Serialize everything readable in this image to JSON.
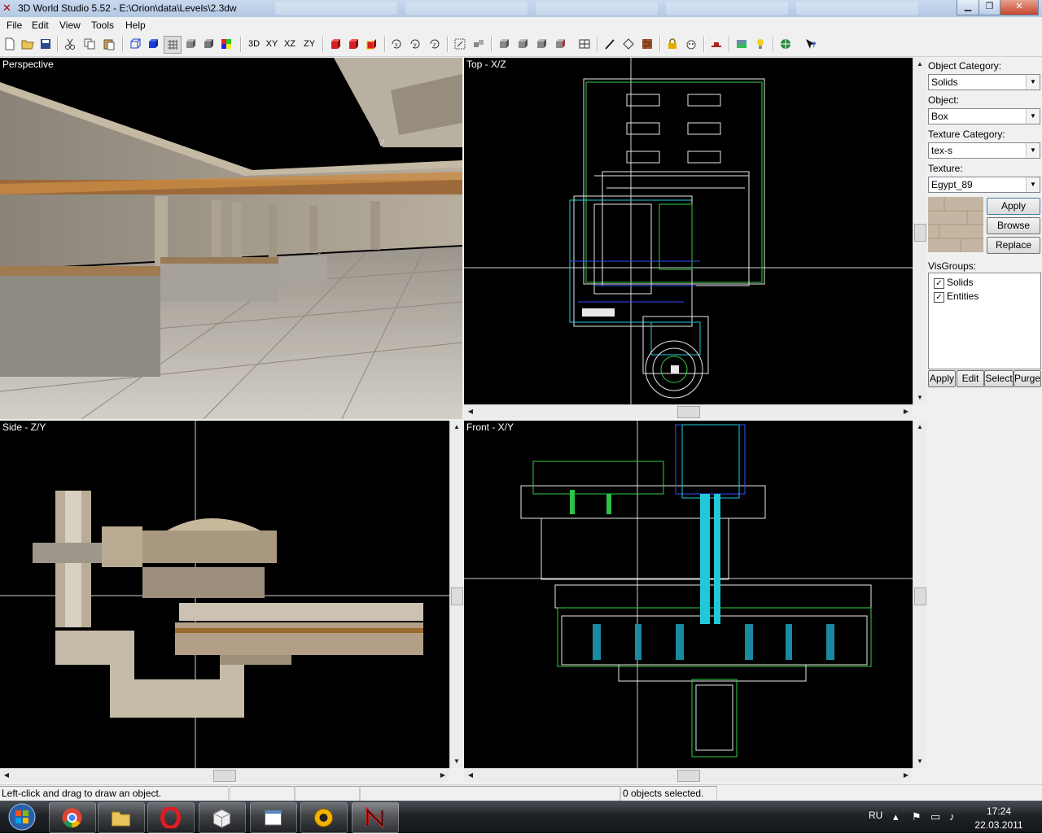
{
  "window": {
    "title": "3D World Studio 5.52 - E:\\Orion\\data\\Levels\\2.3dw",
    "minimize": "▁",
    "restore": "❐",
    "close": "✕"
  },
  "menu": [
    "File",
    "Edit",
    "View",
    "Tools",
    "Help"
  ],
  "toolbar": {
    "view_3d": "3D",
    "view_xy": "XY",
    "view_xz": "XZ",
    "view_zy": "ZY",
    "icons": [
      "new-icon",
      "open-icon",
      "save-icon",
      "cut-icon",
      "copy-icon",
      "paste-icon",
      "cube-wire-icon",
      "cube-solid-icon",
      "grid-icon",
      "shaded-icon",
      "textured-icon",
      "color-icon",
      "red-cube-icon",
      "red-cube-2-icon",
      "red-cube-3-icon",
      "rotate-x-icon",
      "rotate-y-icon",
      "rotate-z-icon",
      "snap-icon",
      "group-icon",
      "solid-1-icon",
      "solid-2-icon",
      "solid-3-icon",
      "solid-4-icon",
      "carve-icon",
      "brush-icon",
      "paint-icon",
      "texture-icon",
      "lock-icon",
      "face-icon",
      "entity-icon",
      "map-icon",
      "light-icon",
      "compile-icon",
      "help-icon"
    ]
  },
  "viewports": {
    "perspective": "Perspective",
    "top": "Top - X/Z",
    "side": "Side - Z/Y",
    "front": "Front - X/Y"
  },
  "panel": {
    "object_category_label": "Object Category:",
    "object_category": "Solids",
    "object_label": "Object:",
    "object": "Box",
    "texture_category_label": "Texture Category:",
    "texture_category": "tex-s",
    "texture_label": "Texture:",
    "texture": "Egypt_89",
    "apply": "Apply",
    "browse": "Browse",
    "replace": "Replace",
    "visgroups_label": "VisGroups:",
    "visgroups": [
      {
        "name": "Solids",
        "checked": true
      },
      {
        "name": "Entities",
        "checked": true
      }
    ],
    "vg_apply": "Apply",
    "vg_edit": "Edit",
    "vg_select": "Select",
    "vg_purge": "Purge",
    "check_mark": "✓"
  },
  "status": {
    "hint": "Left-click and drag to draw an object.",
    "selection": "0 objects selected."
  },
  "taskbar": {
    "apps": [
      "start-orb",
      "chrome",
      "file-explorer",
      "opera",
      "package",
      "notepad",
      "game-shield",
      "3d-world-studio"
    ],
    "lang": "RU",
    "time": "17:24",
    "date": "22.03.2011"
  },
  "colors": {
    "wire_white": "#e8e8e8",
    "wire_green": "#33cc44",
    "wire_cyan": "#22c8d8",
    "wire_blue": "#3050ff",
    "crosshair": "#cfcfcf",
    "sand": "#c8bca8"
  }
}
